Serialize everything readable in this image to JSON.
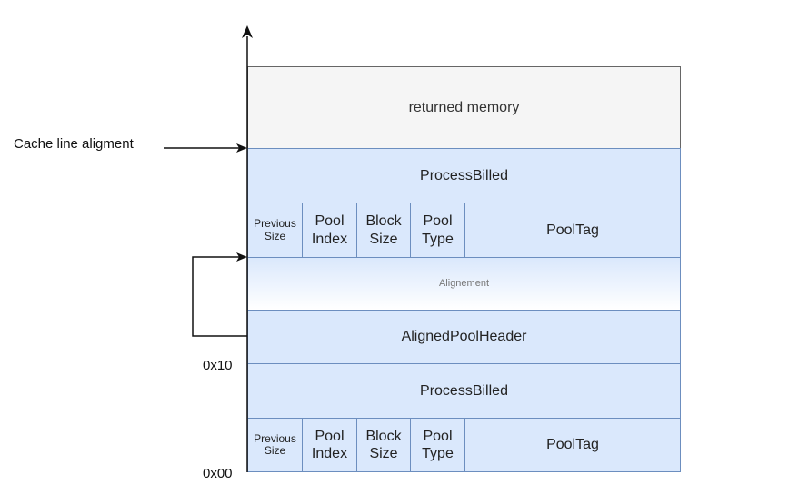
{
  "colors": {
    "header_fill": "#dae8fc",
    "header_stroke": "#6c8ebf",
    "returned_fill": "#f5f5f5",
    "returned_stroke": "#666666"
  },
  "labels": {
    "cache_line": "Cache line aligment",
    "offset_0x10": "0x10",
    "offset_0x00": "0x00"
  },
  "blocks": {
    "returned_memory": "returned memory",
    "process_billed_top": "ProcessBilled",
    "alignment": "Alignement",
    "aligned_pool_header": "AlignedPoolHeader",
    "process_billed_bottom": "ProcessBilled"
  },
  "pool_header_top": {
    "previous_size": "Previous Size",
    "pool_index": "Pool Index",
    "block_size": "Block Size",
    "pool_type": "Pool Type",
    "pool_tag": "PoolTag"
  },
  "pool_header_bottom": {
    "previous_size": "Previous Size",
    "pool_index": "Pool Index",
    "block_size": "Block Size",
    "pool_type": "Pool Type",
    "pool_tag": "PoolTag"
  }
}
